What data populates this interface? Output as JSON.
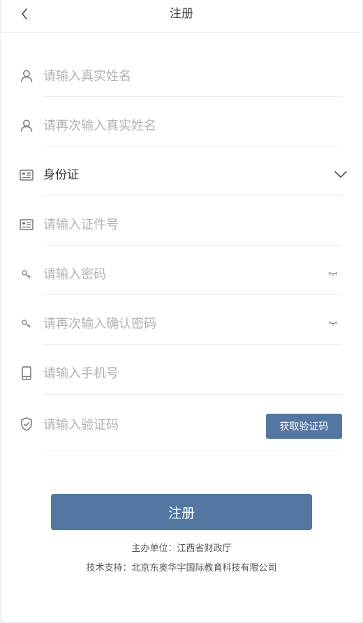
{
  "header": {
    "title": "注册",
    "back_icon": "chevron-left-icon"
  },
  "form": {
    "name": {
      "placeholder": "请输入真实姓名",
      "icon": "user-icon"
    },
    "name_confirm": {
      "placeholder": "请再次输入真实姓名",
      "icon": "user-icon"
    },
    "id_type": {
      "value": "身份证",
      "icon": "id-card-icon",
      "dropdown_icon": "chevron-down-icon"
    },
    "id_number": {
      "placeholder": "请输入证件号",
      "icon": "id-card-icon"
    },
    "password": {
      "placeholder": "请输入密码",
      "icon": "key-icon",
      "toggle_icon": "eye-closed-icon"
    },
    "password_confirm": {
      "placeholder": "请再次输入确认密码",
      "icon": "key-icon",
      "toggle_icon": "eye-closed-icon"
    },
    "phone": {
      "placeholder": "请输入手机号",
      "icon": "phone-icon"
    },
    "code": {
      "placeholder": "请输入验证码",
      "icon": "shield-check-icon",
      "button_label": "获取验证码"
    }
  },
  "submit_label": "注册",
  "footer": {
    "organizer": "主办单位：江西省财政厅",
    "support": "技术支持：北京东奥华宇国际教育科技有限公司"
  },
  "colors": {
    "accent": "#5476a3",
    "placeholder": "#b2b2b2",
    "divider": "#ececec"
  }
}
